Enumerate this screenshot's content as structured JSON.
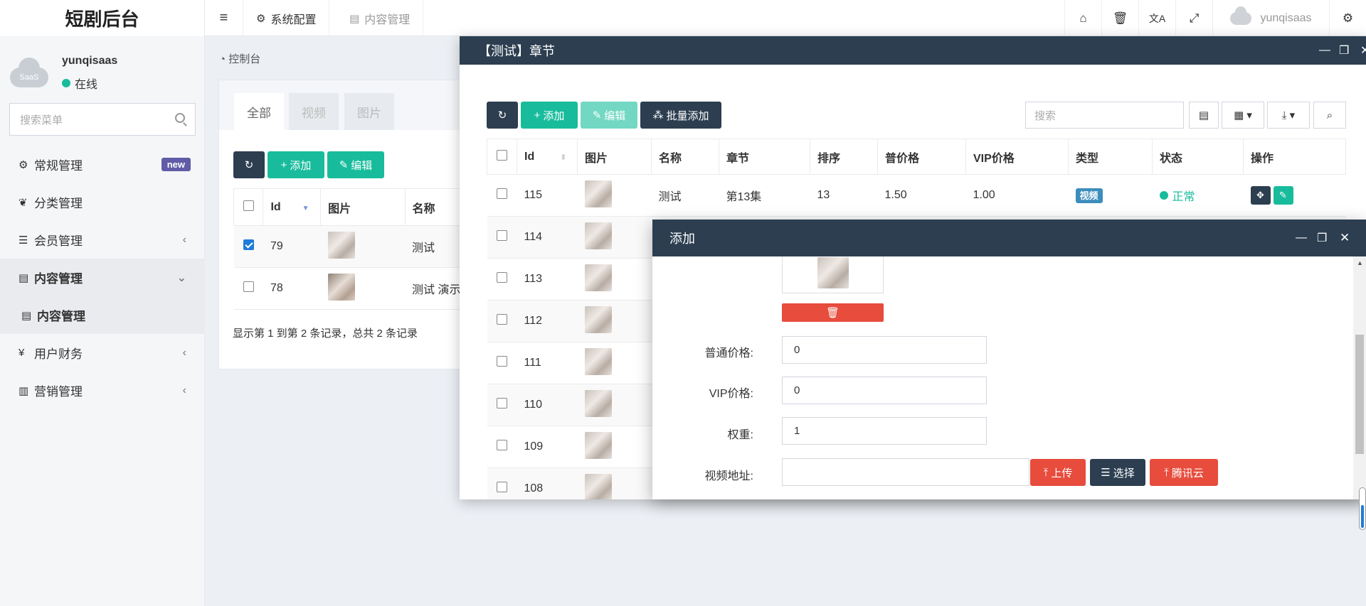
{
  "app": {
    "title": "短剧后台"
  },
  "header": {
    "menu_icon": "hamburger-icon",
    "nav": [
      {
        "label": "系统配置",
        "icon": "gear-icon"
      },
      {
        "label": "内容管理",
        "icon": "file-icon"
      }
    ],
    "user": "yunqisaas"
  },
  "sidebar": {
    "user": {
      "name": "yunqisaas",
      "status": "在线",
      "avatar_text": "SaaS"
    },
    "search_placeholder": "搜索菜单",
    "items": [
      {
        "label": "常规管理",
        "icon": "cogs-icon",
        "badge": "new"
      },
      {
        "label": "分类管理",
        "icon": "leaf-icon"
      },
      {
        "label": "会员管理",
        "icon": "list-icon"
      },
      {
        "label": "内容管理",
        "icon": "file-icon"
      },
      {
        "label": "内容管理",
        "icon": "file-icon"
      },
      {
        "label": "用户财务",
        "icon": "yen-icon"
      },
      {
        "label": "营销管理",
        "icon": "chart-icon"
      }
    ]
  },
  "main": {
    "breadcrumb": "控制台",
    "tabs": [
      "全部",
      "视频",
      "图片"
    ],
    "toolbar": {
      "add": "添加",
      "edit": "编辑"
    },
    "columns": [
      "Id",
      "图片",
      "名称"
    ],
    "rows": [
      {
        "id": "79",
        "name": "测试",
        "checked": true
      },
      {
        "id": "78",
        "name": "测试 演示",
        "checked": false
      }
    ],
    "summary": "显示第 1 到第 2 条记录，总共 2 条记录"
  },
  "chapter_modal": {
    "title": "【测试】章节",
    "toolbar": {
      "add": "添加",
      "edit": "编辑",
      "batch_add": "批量添加"
    },
    "search_placeholder": "搜索",
    "columns": [
      "Id",
      "图片",
      "名称",
      "章节",
      "排序",
      "普价格",
      "VIP价格",
      "类型",
      "状态",
      "操作"
    ],
    "rows": [
      {
        "id": "115",
        "name": "测试",
        "chapter": "第13集",
        "sort": "13",
        "price": "1.50",
        "vip_price": "1.00",
        "type": "视频",
        "status": "正常"
      },
      {
        "id": "114"
      },
      {
        "id": "113"
      },
      {
        "id": "112"
      },
      {
        "id": "111"
      },
      {
        "id": "110"
      },
      {
        "id": "109"
      },
      {
        "id": "108"
      }
    ]
  },
  "add_modal": {
    "title": "添加",
    "fields": {
      "price_label": "普通价格:",
      "price_value": "0",
      "vip_label": "VIP价格:",
      "vip_value": "0",
      "weight_label": "权重:",
      "weight_value": "1",
      "video_label": "视频地址:",
      "video_value": ""
    },
    "buttons": {
      "upload": "上传",
      "choose": "选择",
      "tencent": "腾讯云"
    }
  }
}
